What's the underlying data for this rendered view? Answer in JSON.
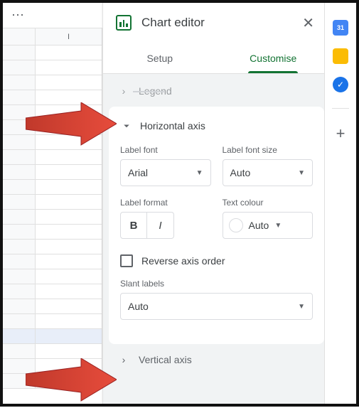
{
  "sheet": {
    "column_header": "I"
  },
  "panel": {
    "title": "Chart editor",
    "tabs": {
      "setup": "Setup",
      "customise": "Customise"
    }
  },
  "sections": {
    "legend": {
      "label": "Legend"
    },
    "horizontal": {
      "title": "Horizontal axis",
      "label_font": {
        "label": "Label font",
        "value": "Arial"
      },
      "label_font_size": {
        "label": "Label font size",
        "value": "Auto"
      },
      "label_format": {
        "label": "Label format"
      },
      "text_colour": {
        "label": "Text colour",
        "value": "Auto"
      },
      "reverse": "Reverse axis order",
      "slant": {
        "label": "Slant labels",
        "value": "Auto"
      }
    },
    "vertical": {
      "label": "Vertical axis"
    }
  }
}
